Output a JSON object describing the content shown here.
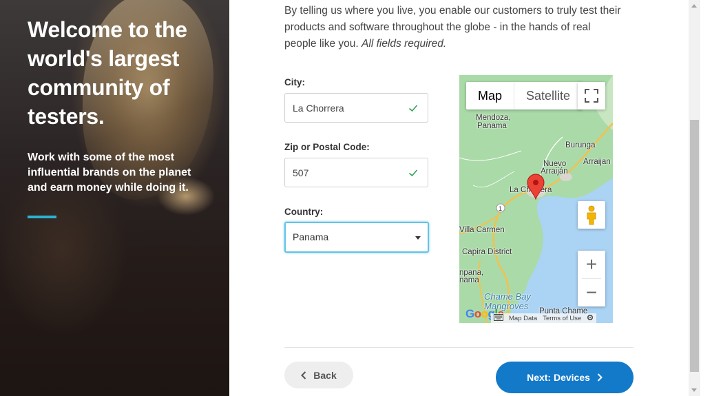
{
  "hero": {
    "title": "Welcome to the world's largest community of testers.",
    "subtitle": "Work with some of the most influential brands on the planet and earn money while doing it.",
    "accent_color": "#2ab3d3"
  },
  "intro": {
    "text": "By telling us where you live, you enable our customers to truly test their products and software throughout the globe - in the hands of real people like you.",
    "note": "All fields required."
  },
  "form": {
    "city": {
      "label": "City:",
      "value": "La Chorrera",
      "valid": true
    },
    "zip": {
      "label": "Zip or Postal Code:",
      "value": "507",
      "valid": true
    },
    "country": {
      "label": "Country:",
      "value": "Panama"
    }
  },
  "map": {
    "tabs": [
      "Map",
      "Satellite"
    ],
    "active_tab": "Map",
    "labels": {
      "mendoza": "Mendoza,",
      "panama1": "Panama",
      "burunga": "Burunga",
      "nuevo": "Nuevo",
      "arraijan1": "Arraiján",
      "arraijan2": "Arraijan",
      "lachorrera": "La Chorrera",
      "route": "1",
      "villacarmen": "Villa Carmen",
      "capira": "Capira District",
      "panama2a": "npana,",
      "panama2b": "nama",
      "chame1": "Chame Bay",
      "chame2": "Mangroves",
      "puntachame": "Punta Chame"
    },
    "google": "Google",
    "footer": [
      "Map Data",
      "Terms of Use"
    ],
    "zoom_in": "+",
    "zoom_out": "−"
  },
  "nav": {
    "back": "Back",
    "next": "Next: Devices",
    "next_color": "#1379c9"
  }
}
